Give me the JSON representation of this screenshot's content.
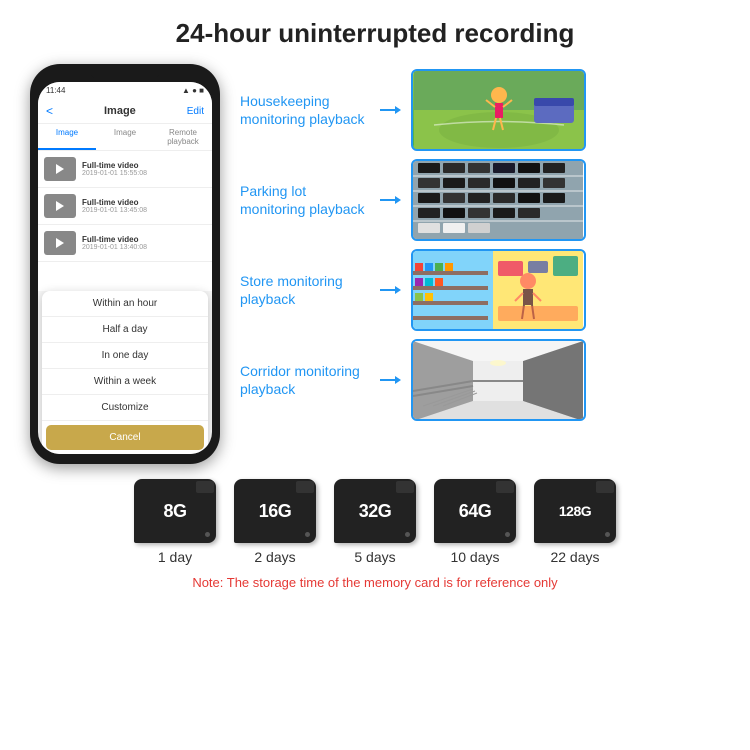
{
  "header": {
    "title": "24-hour uninterrupted recording"
  },
  "phone": {
    "time": "11:44",
    "screen_title": "Image",
    "edit_label": "Edit",
    "back_label": "<",
    "tabs": [
      "Image",
      "Image",
      "Remote playback"
    ],
    "active_tab": 0,
    "videos": [
      {
        "title": "Full-time video",
        "date": "2019-01-01 15:55:08"
      },
      {
        "title": "Full-time video",
        "date": "2019-01-01 13:45:08"
      },
      {
        "title": "Full-time video",
        "date": "2019-01-01 13:40:08"
      }
    ],
    "dropdown_items": [
      "Within an hour",
      "Half a day",
      "In one day",
      "Within a week",
      "Customize"
    ],
    "cancel_label": "Cancel"
  },
  "monitoring": {
    "items": [
      {
        "label": "Housekeeping monitoring playback",
        "img_class": "img-housekeeping"
      },
      {
        "label": "Parking lot monitoring playback",
        "img_class": "img-parking"
      },
      {
        "label": "Store monitoring playback",
        "img_class": "img-store"
      },
      {
        "label": "Corridor monitoring playback",
        "img_class": "img-corridor"
      }
    ]
  },
  "storage": {
    "cards": [
      {
        "size": "8G",
        "days": "1 day"
      },
      {
        "size": "16G",
        "days": "2 days"
      },
      {
        "size": "32G",
        "days": "5 days"
      },
      {
        "size": "64G",
        "days": "10 days"
      },
      {
        "size": "128G",
        "days": "22 days"
      }
    ],
    "note": "Note: The storage time of the memory card is for reference only"
  }
}
